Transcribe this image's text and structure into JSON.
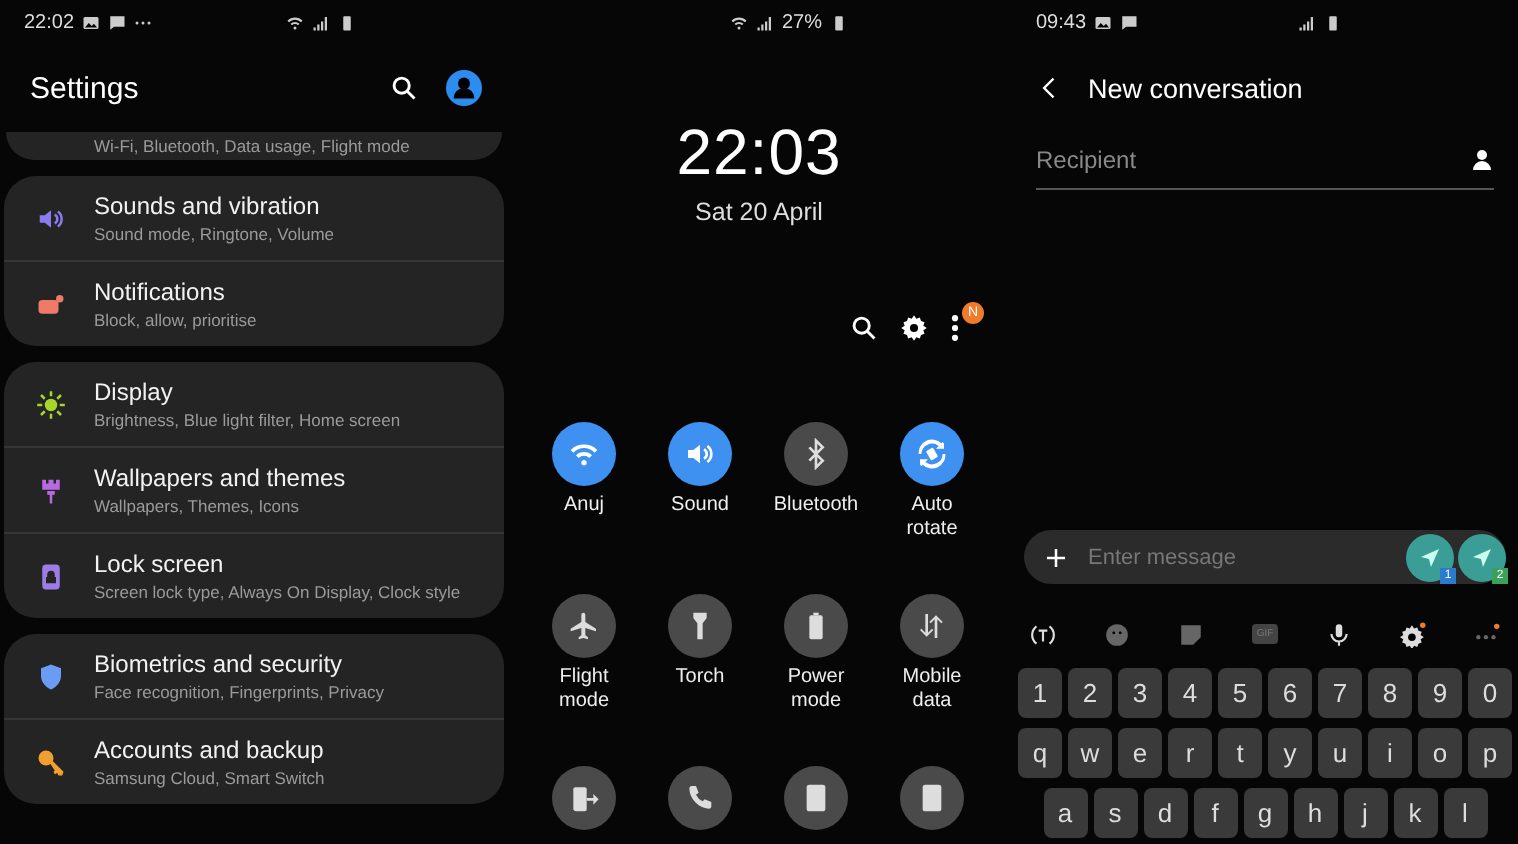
{
  "settings_screen": {
    "status_bar": {
      "time": "22:02"
    },
    "title": "Settings",
    "cut_item_subtitle": "Wi-Fi, Bluetooth, Data usage, Flight mode",
    "groups": [
      {
        "items": [
          {
            "title": "Sounds and vibration",
            "subtitle": "Sound mode, Ringtone, Volume",
            "color": "#8a7cf0"
          },
          {
            "title": "Notifications",
            "subtitle": "Block, allow, prioritise",
            "color": "#f07a6a"
          }
        ]
      },
      {
        "items": [
          {
            "title": "Display",
            "subtitle": "Brightness, Blue light filter, Home screen",
            "color": "#a6d62b"
          },
          {
            "title": "Wallpapers and themes",
            "subtitle": "Wallpapers, Themes, Icons",
            "color": "#b86ae0"
          },
          {
            "title": "Lock screen",
            "subtitle": "Screen lock type, Always On Display, Clock style",
            "color": "#9c7de8"
          }
        ]
      },
      {
        "items": [
          {
            "title": "Biometrics and security",
            "subtitle": "Face recognition, Fingerprints, Privacy",
            "color": "#6a9cf5"
          },
          {
            "title": "Accounts and backup",
            "subtitle": "Samsung Cloud, Smart Switch",
            "color": "#f0a030"
          }
        ]
      }
    ]
  },
  "quick_panel": {
    "status_bar": {
      "battery": "27%"
    },
    "time": "22:03",
    "date": "Sat 20 April",
    "more_badge": "N",
    "tiles": [
      {
        "label": "Anuj",
        "on": true
      },
      {
        "label": "Sound",
        "on": true
      },
      {
        "label": "Bluetooth",
        "on": false
      },
      {
        "label": "Auto rotate",
        "on": true
      },
      {
        "label": "Flight mode",
        "on": false
      },
      {
        "label": "Torch",
        "on": false
      },
      {
        "label": "Power mode",
        "on": false
      },
      {
        "label": "Mobile data",
        "on": false
      },
      {
        "on": false
      },
      {
        "on": false
      },
      {
        "on": false
      },
      {
        "on": false
      }
    ]
  },
  "messages_screen": {
    "status_bar": {
      "time": "09:43"
    },
    "title": "New conversation",
    "recipient": {
      "placeholder": "Recipient"
    },
    "message": {
      "placeholder": "Enter message"
    },
    "send_buttons": [
      {
        "sim": "1"
      },
      {
        "sim": "2"
      }
    ],
    "toolbar": {
      "gif_label": "GIF"
    },
    "keyboard": {
      "rows": [
        [
          "1",
          "2",
          "3",
          "4",
          "5",
          "6",
          "7",
          "8",
          "9",
          "0"
        ],
        [
          "q",
          "w",
          "e",
          "r",
          "t",
          "y",
          "u",
          "i",
          "o",
          "p"
        ],
        [
          "a",
          "s",
          "d",
          "f",
          "g",
          "h",
          "j",
          "k",
          "l"
        ]
      ]
    }
  }
}
